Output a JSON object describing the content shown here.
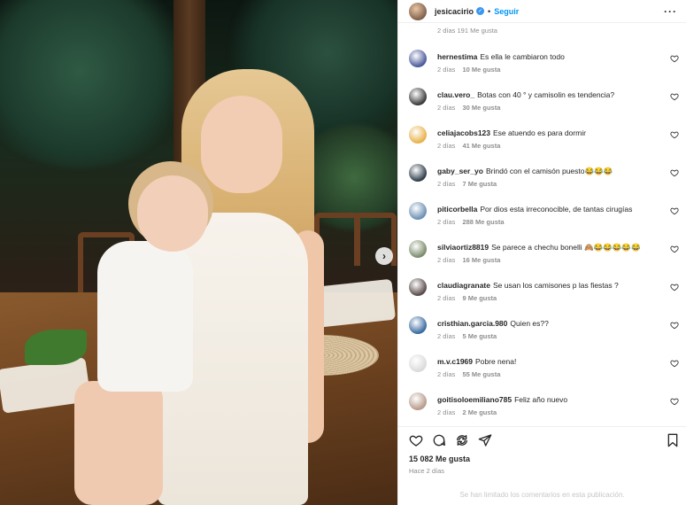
{
  "post": {
    "username": "jesicacirio",
    "separator": "•",
    "follow_label": "Seguir",
    "more_label": "···",
    "top_meta": "2 días   191 Me gusta",
    "likes": "15 082 Me gusta",
    "time_ago": "Hace 2 días",
    "footer_note": "Se han limitado los comentarios en esta publicación."
  },
  "comments": [
    {
      "user": "hernestima",
      "text": "Es ella le cambiaron todo",
      "days": "2 días",
      "likes": "10 Me gusta",
      "avatar_color": "#4b5a9a"
    },
    {
      "user": "clau.vero_",
      "text": "Botas con 40 ° y camisolin es tendencia?",
      "days": "2 días",
      "likes": "30 Me gusta",
      "avatar_color": "#3a3a3a"
    },
    {
      "user": "celiajacobs123",
      "text": "Ese atuendo es para dormir",
      "days": "2 días",
      "likes": "41 Me gusta",
      "avatar_color": "#e8b24a"
    },
    {
      "user": "gaby_ser_yo",
      "text": "Brindó con el camisón puesto😂😂😂",
      "days": "2 días",
      "likes": "7 Me gusta",
      "avatar_color": "#2f3d4a"
    },
    {
      "user": "piticorbella",
      "text": "Por dios esta irreconocible, de tantas cirugías",
      "days": "2 días",
      "likes": "288 Me gusta",
      "avatar_color": "#6b8fb4"
    },
    {
      "user": "silviaortiz8819",
      "text": "Se parece a chechu bonelli 🙈😂😂😂😂😂",
      "days": "2 días",
      "likes": "16 Me gusta",
      "avatar_color": "#7a8b6a"
    },
    {
      "user": "claudiagranate",
      "text": "Se usan los camisones p las fiestas ?",
      "days": "2 días",
      "likes": "9 Me gusta",
      "avatar_color": "#5a4a4a"
    },
    {
      "user": "cristhian.garcia.980",
      "text": "Quien es??",
      "days": "2 días",
      "likes": "5 Me gusta",
      "avatar_color": "#3a6aa0"
    },
    {
      "user": "m.v.c1969",
      "text": "Pobre nena!",
      "days": "2 días",
      "likes": "55 Me gusta",
      "avatar_color": "#dadada"
    },
    {
      "user": "goitisoloemiliano785",
      "text": "Feliz año nuevo",
      "days": "2 días",
      "likes": "2 Me gusta",
      "avatar_color": "#b89a8a"
    }
  ],
  "colors": {
    "accent": "#0095f6",
    "verified": "#3897f0",
    "muted": "#8e8e8e"
  },
  "icons": [
    "heart-icon",
    "comment-icon",
    "share-icon",
    "send-icon",
    "bookmark-icon",
    "carousel-next-icon"
  ]
}
